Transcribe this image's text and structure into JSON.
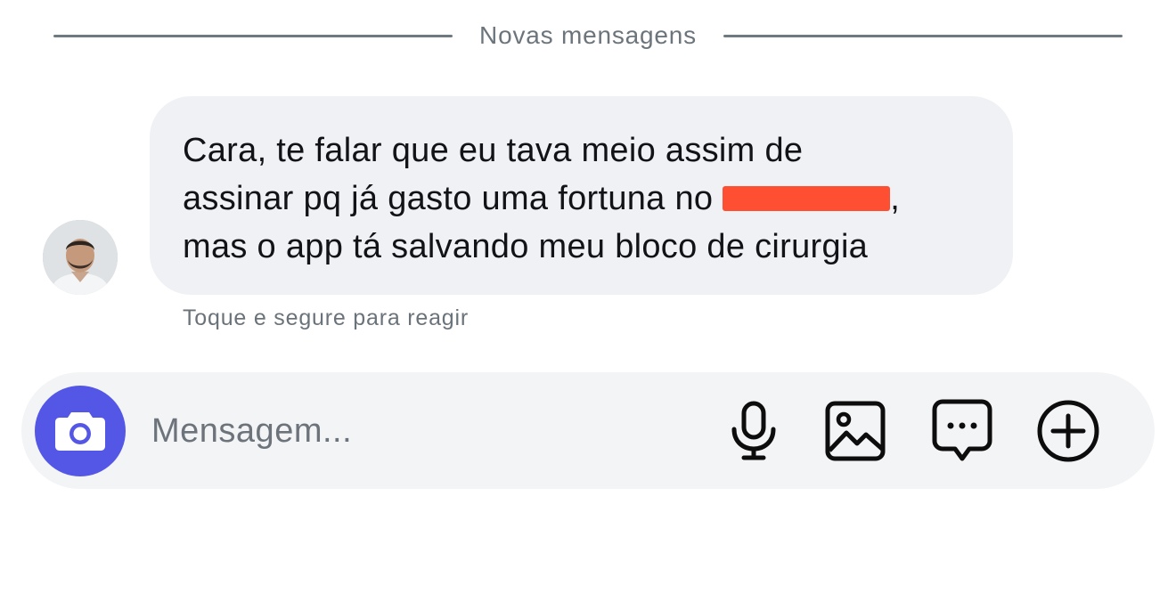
{
  "divider": {
    "label": "Novas mensagens"
  },
  "message": {
    "lines": [
      "Cara, te falar que eu tava meio assim de",
      "assinar pq já gasto uma fortuna no ",
      ",",
      "mas o app tá salvando meu bloco de cirurgia"
    ],
    "redaction_color": "#ff4f33"
  },
  "hint": "Toque e segure para reagir",
  "composer": {
    "placeholder": "Mensagem...",
    "accent_color": "#5457e6",
    "icons": [
      "camera-icon",
      "microphone-icon",
      "image-icon",
      "chat-bubble-icon",
      "plus-circle-icon"
    ]
  }
}
